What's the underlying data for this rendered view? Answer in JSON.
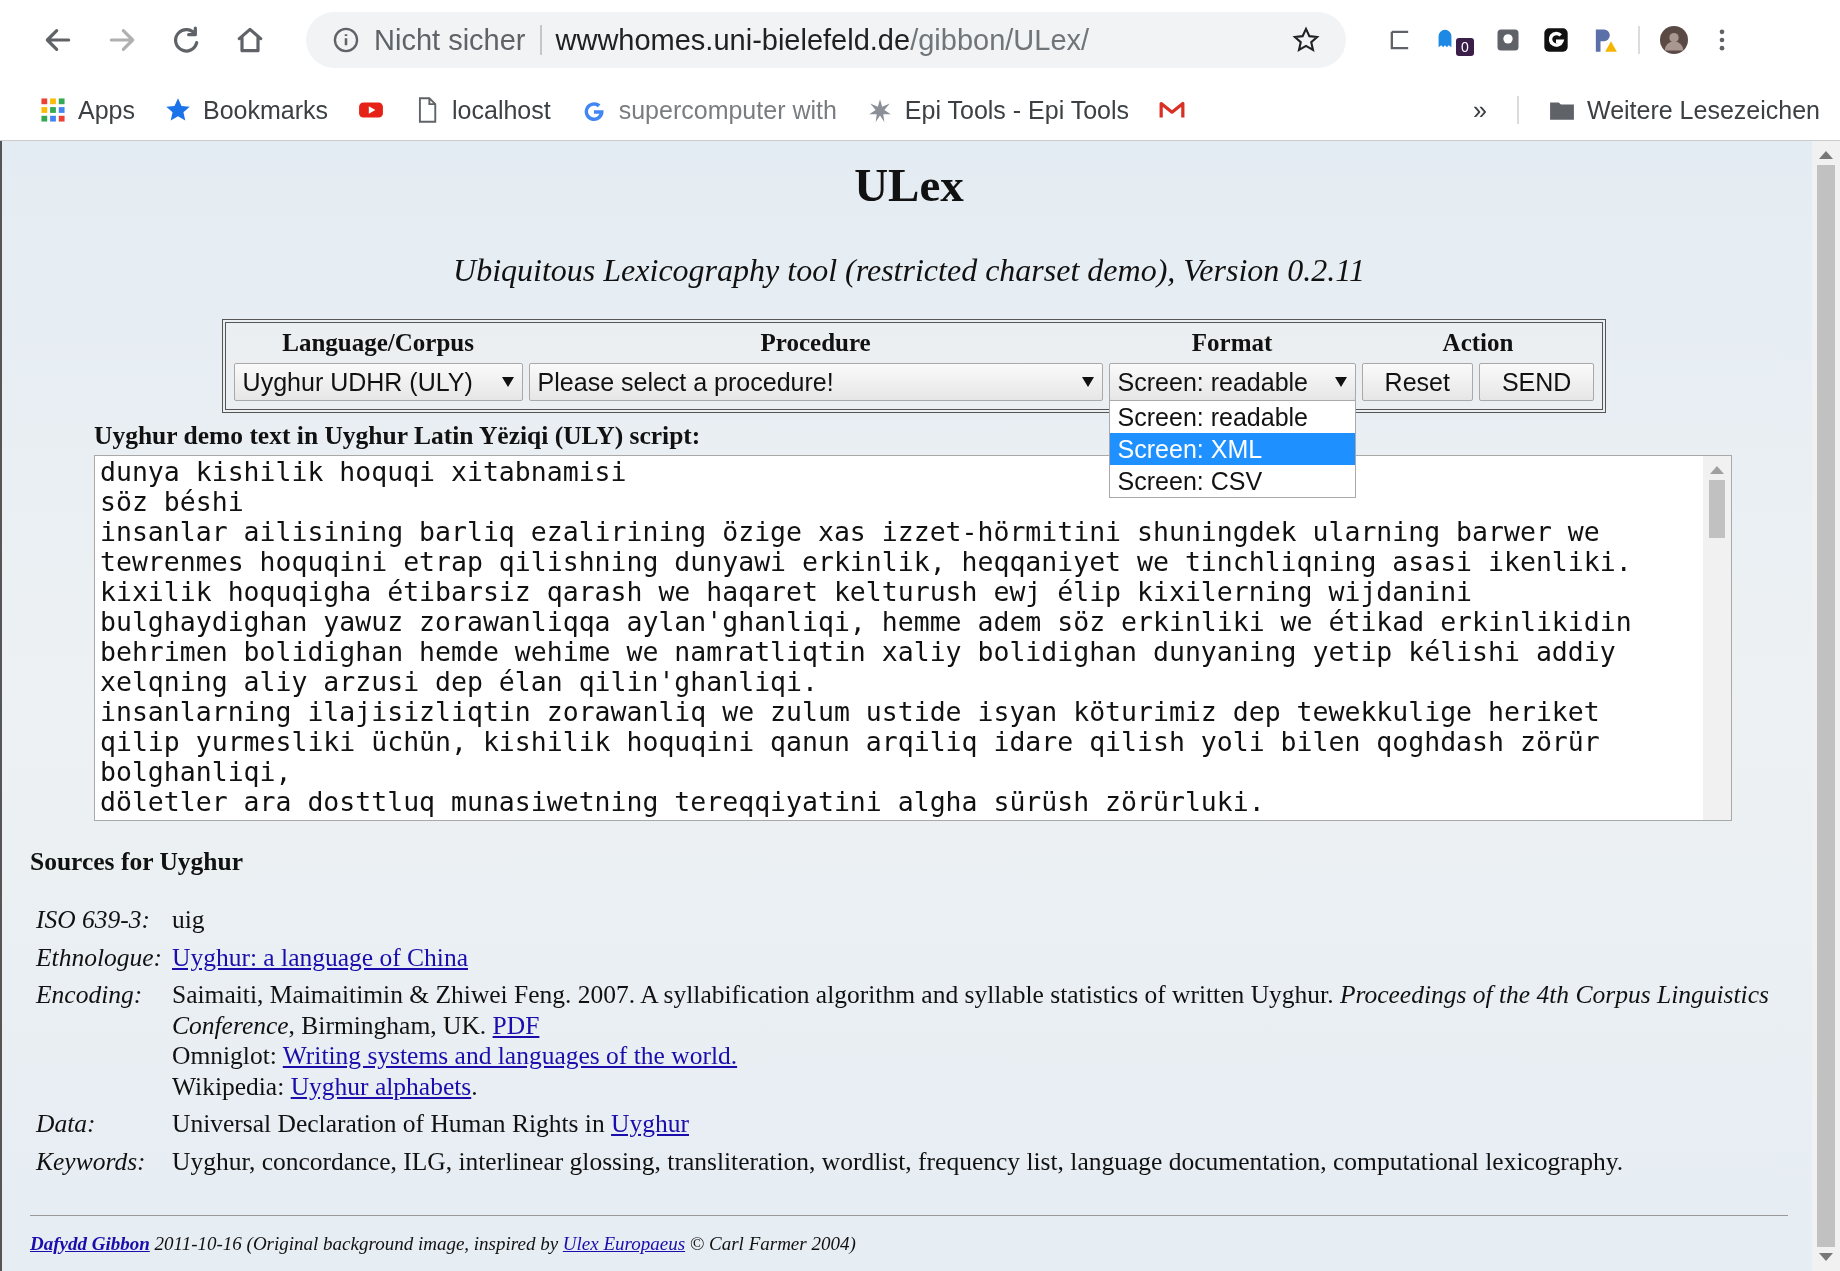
{
  "browser": {
    "nav": [
      {
        "kind": "back",
        "disabled": false
      },
      {
        "kind": "forward",
        "disabled": true
      },
      {
        "kind": "reload",
        "disabled": false
      },
      {
        "kind": "home",
        "disabled": false
      }
    ],
    "address": {
      "security": "Nicht sicher",
      "host": "wwwhomes.uni-bielefeld.de",
      "path": "/gibbon/ULex/"
    },
    "extension_badge": "0",
    "bookmarks": [
      {
        "kind": "apps",
        "label": "Apps"
      },
      {
        "kind": "star",
        "label": "Bookmarks"
      },
      {
        "kind": "video"
      },
      {
        "kind": "page",
        "label": "localhost"
      },
      {
        "kind": "g",
        "label": "supercomputer with"
      },
      {
        "kind": "tool",
        "label": "Epi Tools - Epi Tools"
      },
      {
        "kind": "mail"
      }
    ],
    "overflow": "»",
    "other_bookmarks": "Weitere Lesezeichen"
  },
  "page": {
    "title": "ULex",
    "subtitle": "Ubiquitous Lexicography tool (restricted charset demo), Version 0.2.11",
    "form": {
      "columns": [
        "Language/Corpus",
        "Procedure",
        "Format",
        "Action"
      ],
      "language": "Uyghur UDHR (ULY)",
      "procedure": "Please select a procedure!",
      "format": "Screen: readable",
      "format_options": [
        {
          "label": "Screen: readable",
          "selected": false
        },
        {
          "label": "Screen: XML",
          "selected": true
        },
        {
          "label": "Screen: CSV",
          "selected": false
        }
      ],
      "buttons": [
        "Reset",
        "SEND"
      ]
    },
    "text_label": "Uyghur demo text in Uyghur Latin Yëziqi (ULY) script:",
    "text_lines": [
      "dunya kishilik hoquqi xitabnamisi",
      "söz béshi",
      "insanlar ailisining barliq ezalirining özige xas izzet-hörmitini shuningdek ularning barwer we",
      "tewrenmes hoquqini etrap qilishning dunyawi erkinlik, heqqaniyet we tinchliqning asasi ikenliki.",
      "kixilik hoquqigha étibarsiz qarash we haqaret kelturush ewj élip kixilerning wijdanini",
      "bulghaydighan yawuz zorawanliqqa aylan'ghanliqi, hemme adem söz erkinliki we étikad erkinlikidin",
      "behrimen bolidighan hemde wehime we namratliqtin xaliy bolidighan dunyaning yetip kélishi addiy",
      "xelqning aliy arzusi dep élan qilin'ghanliqi.",
      "insanlarning ilajisizliqtin zorawanliq we zulum ustide isyan köturimiz dep tewekkulige heriket",
      "qilip yurmesliki üchün, kishilik hoquqini qanun arqiliq idare qilish yoli bilen qoghdash zörür",
      "bolghanliqi,",
      "döletler ara dosttluq munasiwetning tereqqiyatini algha sürüsh zörürluki."
    ],
    "sources_title": "Sources for Uyghur",
    "sources": [
      {
        "label": "ISO 639-3:",
        "paragraphs": [
          [
            {
              "kind": "text",
              "text": "uig"
            }
          ]
        ]
      },
      {
        "label": "Ethnologue:",
        "paragraphs": [
          [
            {
              "kind": "link",
              "text": "Uyghur: a language of China"
            }
          ]
        ]
      },
      {
        "label": "Encoding:",
        "paragraphs": [
          [
            {
              "kind": "text",
              "text": "Saimaiti, Maimaitimin & Zhiwei Feng. 2007. A syllabification algorithm and syllable statistics of written Uyghur. "
            },
            {
              "kind": "italic",
              "text": "Proceedings of the 4th Corpus Linguistics Conference"
            },
            {
              "kind": "text",
              "text": ", Birmingham, UK. "
            },
            {
              "kind": "link",
              "text": "PDF"
            }
          ],
          [
            {
              "kind": "text",
              "text": "Omniglot: "
            },
            {
              "kind": "link",
              "text": "Writing systems and languages of the world."
            }
          ],
          [
            {
              "kind": "text",
              "text": "Wikipedia: "
            },
            {
              "kind": "link",
              "text": "Uyghur alphabets"
            },
            {
              "kind": "text",
              "text": "."
            }
          ]
        ]
      },
      {
        "label": "Data:",
        "paragraphs": [
          [
            {
              "kind": "text",
              "text": "Universal Declaration of Human Rights in "
            },
            {
              "kind": "link",
              "text": "Uyghur"
            }
          ]
        ]
      },
      {
        "label": "Keywords:",
        "paragraphs": [
          [
            {
              "kind": "text",
              "text": "Uyghur, concordance, ILG, interlinear glossing, transliteration, wordlist, frequency list, language documentation, computational lexicography."
            }
          ]
        ]
      }
    ],
    "footer": [
      {
        "kind": "author",
        "text": "Dafydd Gibbon"
      },
      {
        "kind": "text",
        "text": " 2011-10-16 (Original background image, inspired by "
      },
      {
        "kind": "link",
        "text": "Ulex Europaeus"
      },
      {
        "kind": "text",
        "text": " © Carl Farmer 2004)"
      }
    ]
  }
}
